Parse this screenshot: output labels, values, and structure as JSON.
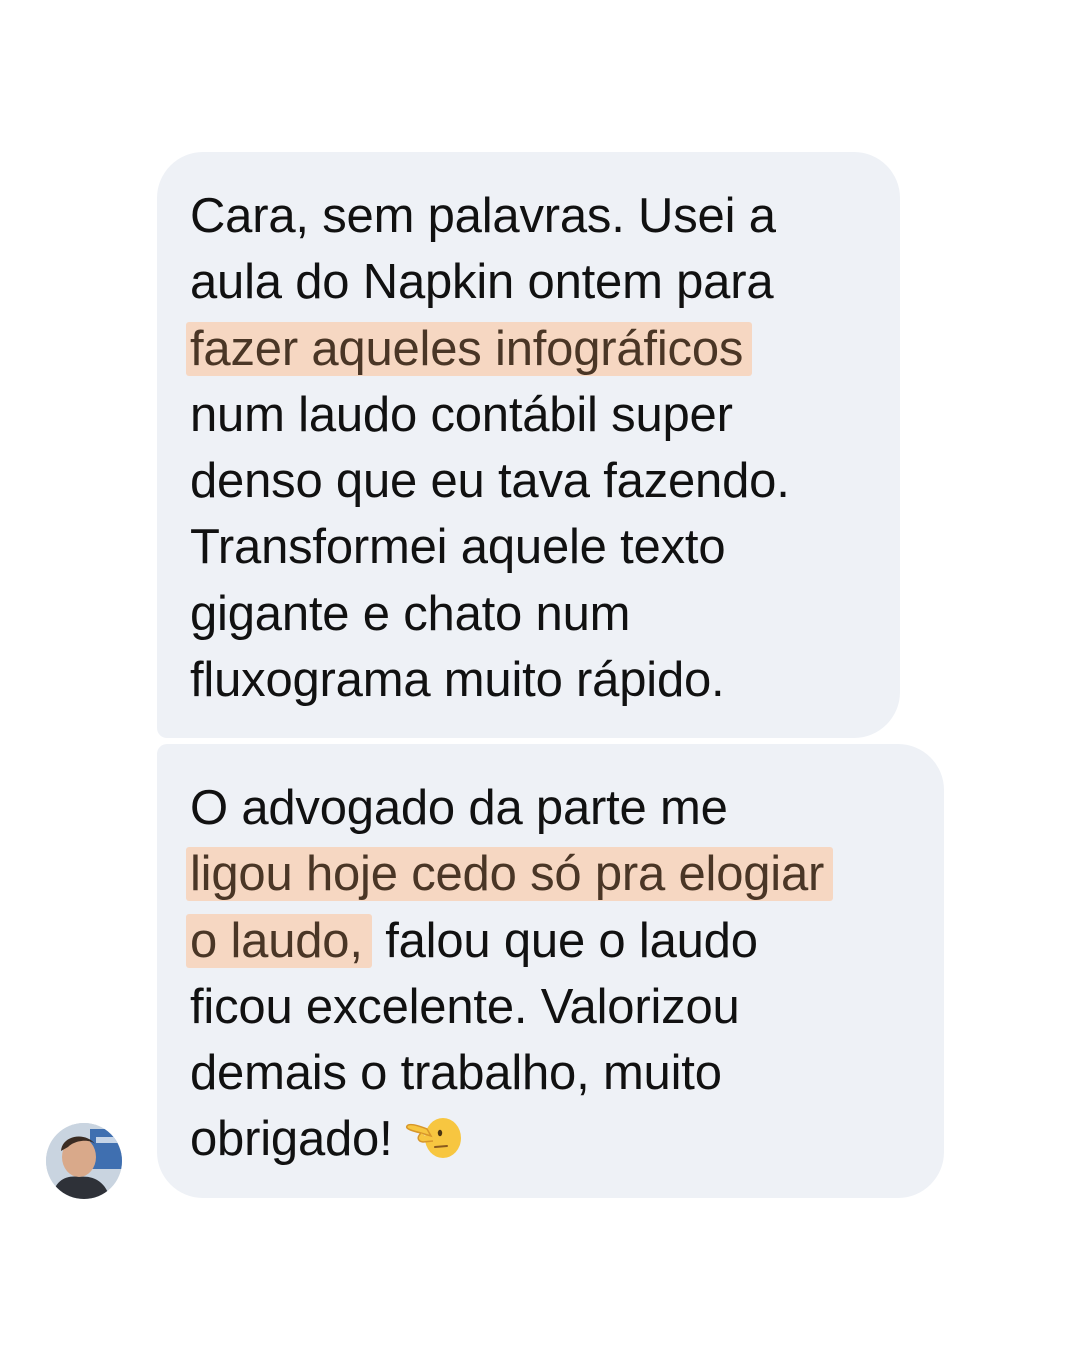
{
  "messages": [
    {
      "lines": [
        "Cara, sem palavras. Usei a",
        "aula do Napkin ontem para",
        "fazer aqueles infográficos",
        "num laudo contábil super",
        "denso que eu tava fazendo.",
        "Transformei aquele texto",
        "gigante e chato num",
        "fluxograma muito rápido."
      ]
    },
    {
      "lines": [
        "O advogado da parte me",
        "ligou hoje cedo só pra elogiar",
        "o laudo,",
        " falou que o laudo",
        "ficou excelente. Valorizou",
        "demais o trabalho, muito",
        "obrigado!"
      ],
      "emoji": "pointing-left-hand-face-emoji"
    }
  ],
  "colors": {
    "bubble": "#eef1f6",
    "highlight": "#f6d7c2",
    "text": "#111111"
  }
}
